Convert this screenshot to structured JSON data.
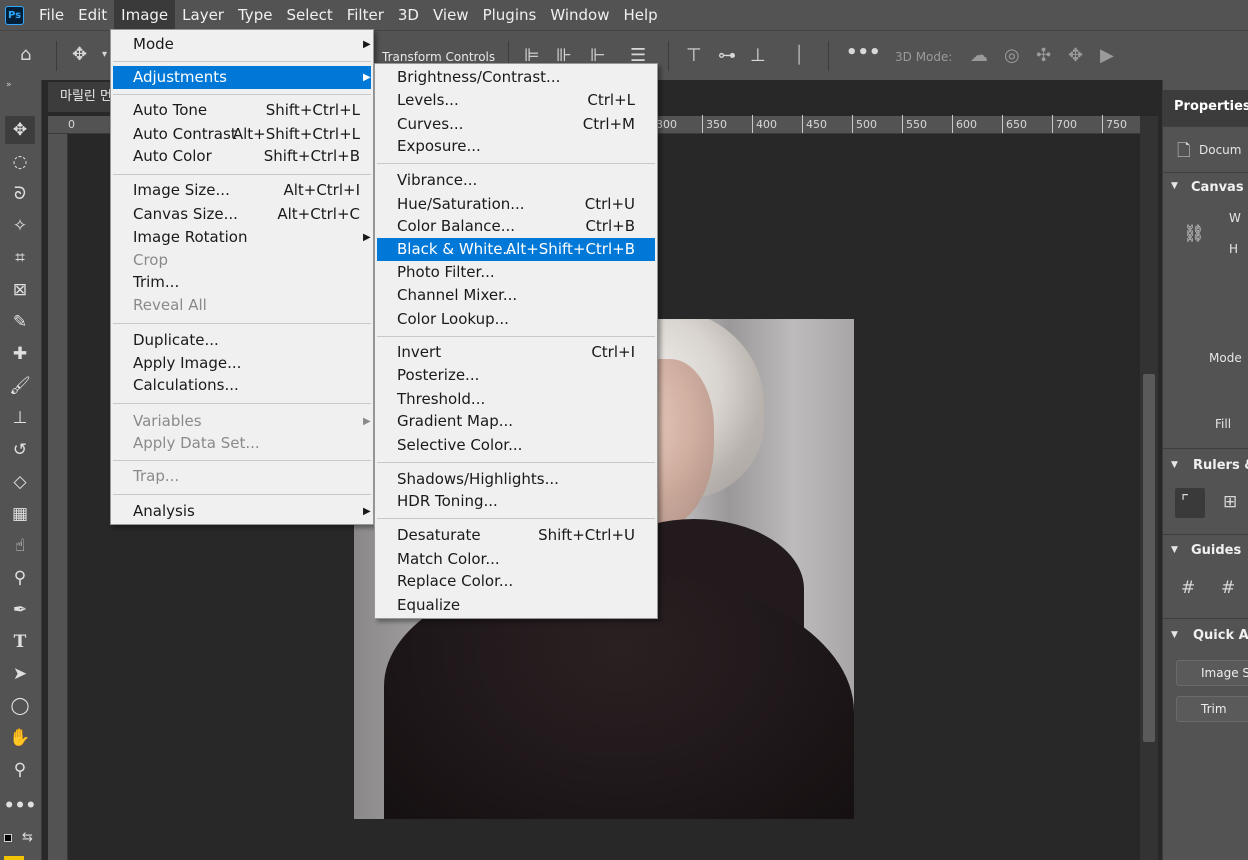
{
  "app": {
    "logo_text": "Ps"
  },
  "menubar": [
    "File",
    "Edit",
    "Image",
    "Layer",
    "Type",
    "Select",
    "Filter",
    "3D",
    "View",
    "Plugins",
    "Window",
    "Help"
  ],
  "options_bar": {
    "transform_controls": "Transform Controls",
    "mode_label": "3D Mode:"
  },
  "document": {
    "tab_title": "마릴린 먼"
  },
  "ruler": {
    "h_labels": [
      "0",
      "300",
      "350",
      "400",
      "450",
      "500",
      "550",
      "600",
      "650",
      "700",
      "750"
    ]
  },
  "image_menu": {
    "items": [
      {
        "label": "Mode",
        "submenu": true
      },
      {
        "label": "Adjustments",
        "submenu": true,
        "highlighted": true
      },
      {
        "label": "Auto Tone",
        "shortcut": "Shift+Ctrl+L"
      },
      {
        "label": "Auto Contrast",
        "shortcut": "Alt+Shift+Ctrl+L"
      },
      {
        "label": "Auto Color",
        "shortcut": "Shift+Ctrl+B"
      },
      {
        "label": "Image Size...",
        "shortcut": "Alt+Ctrl+I"
      },
      {
        "label": "Canvas Size...",
        "shortcut": "Alt+Ctrl+C"
      },
      {
        "label": "Image Rotation",
        "submenu": true
      },
      {
        "label": "Crop",
        "disabled": true
      },
      {
        "label": "Trim..."
      },
      {
        "label": "Reveal All",
        "disabled": true
      },
      {
        "label": "Duplicate..."
      },
      {
        "label": "Apply Image..."
      },
      {
        "label": "Calculations..."
      },
      {
        "label": "Variables",
        "disabled": true,
        "submenu": true
      },
      {
        "label": "Apply Data Set...",
        "disabled": true
      },
      {
        "label": "Trap...",
        "disabled": true
      },
      {
        "label": "Analysis",
        "submenu": true
      }
    ]
  },
  "adjustments_menu": {
    "items": [
      {
        "label": "Brightness/Contrast..."
      },
      {
        "label": "Levels...",
        "shortcut": "Ctrl+L"
      },
      {
        "label": "Curves...",
        "shortcut": "Ctrl+M"
      },
      {
        "label": "Exposure..."
      },
      {
        "label": "Vibrance..."
      },
      {
        "label": "Hue/Saturation...",
        "shortcut": "Ctrl+U"
      },
      {
        "label": "Color Balance...",
        "shortcut": "Ctrl+B"
      },
      {
        "label": "Black & White...",
        "shortcut": "Alt+Shift+Ctrl+B",
        "highlighted": true
      },
      {
        "label": "Photo Filter..."
      },
      {
        "label": "Channel Mixer..."
      },
      {
        "label": "Color Lookup..."
      },
      {
        "label": "Invert",
        "shortcut": "Ctrl+I"
      },
      {
        "label": "Posterize..."
      },
      {
        "label": "Threshold..."
      },
      {
        "label": "Gradient Map..."
      },
      {
        "label": "Selective Color..."
      },
      {
        "label": "Shadows/Highlights..."
      },
      {
        "label": "HDR Toning..."
      },
      {
        "label": "Desaturate",
        "shortcut": "Shift+Ctrl+U"
      },
      {
        "label": "Match Color..."
      },
      {
        "label": "Replace Color..."
      },
      {
        "label": "Equalize"
      }
    ]
  },
  "properties_panel": {
    "tab": "Properties",
    "doc_label": "Docum",
    "canvas_header": "Canvas",
    "w_label": "W",
    "h_label": "H",
    "mode_label": "Mode",
    "fill_label": "Fill",
    "rulers_header": "Rulers &",
    "guides_header": "Guides",
    "quick_actions_header": "Quick Act",
    "image_size_button": "Image S",
    "trim_button": "Trim"
  },
  "colors": {
    "menu_highlight": "#0078d7",
    "chrome": "#535353",
    "canvas_bg": "#282828"
  }
}
